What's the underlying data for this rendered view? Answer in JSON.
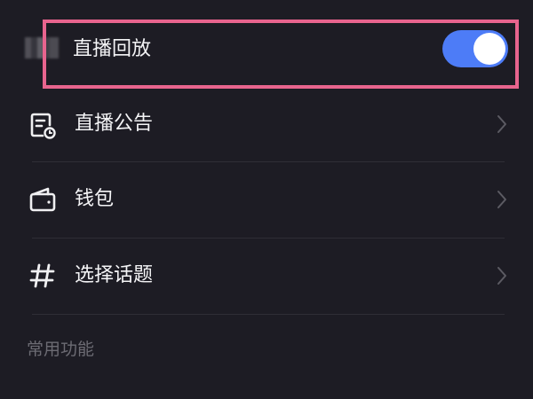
{
  "replay": {
    "label": "直播回放",
    "enabled": true,
    "toggle_color": "#4d7cf7",
    "highlight_color": "#e8648e"
  },
  "menu": [
    {
      "label": "直播公告",
      "icon": "document-clock-icon"
    },
    {
      "label": "钱包",
      "icon": "wallet-icon"
    },
    {
      "label": "选择话题",
      "icon": "hashtag-icon"
    }
  ],
  "section": {
    "title": "常用功能"
  }
}
